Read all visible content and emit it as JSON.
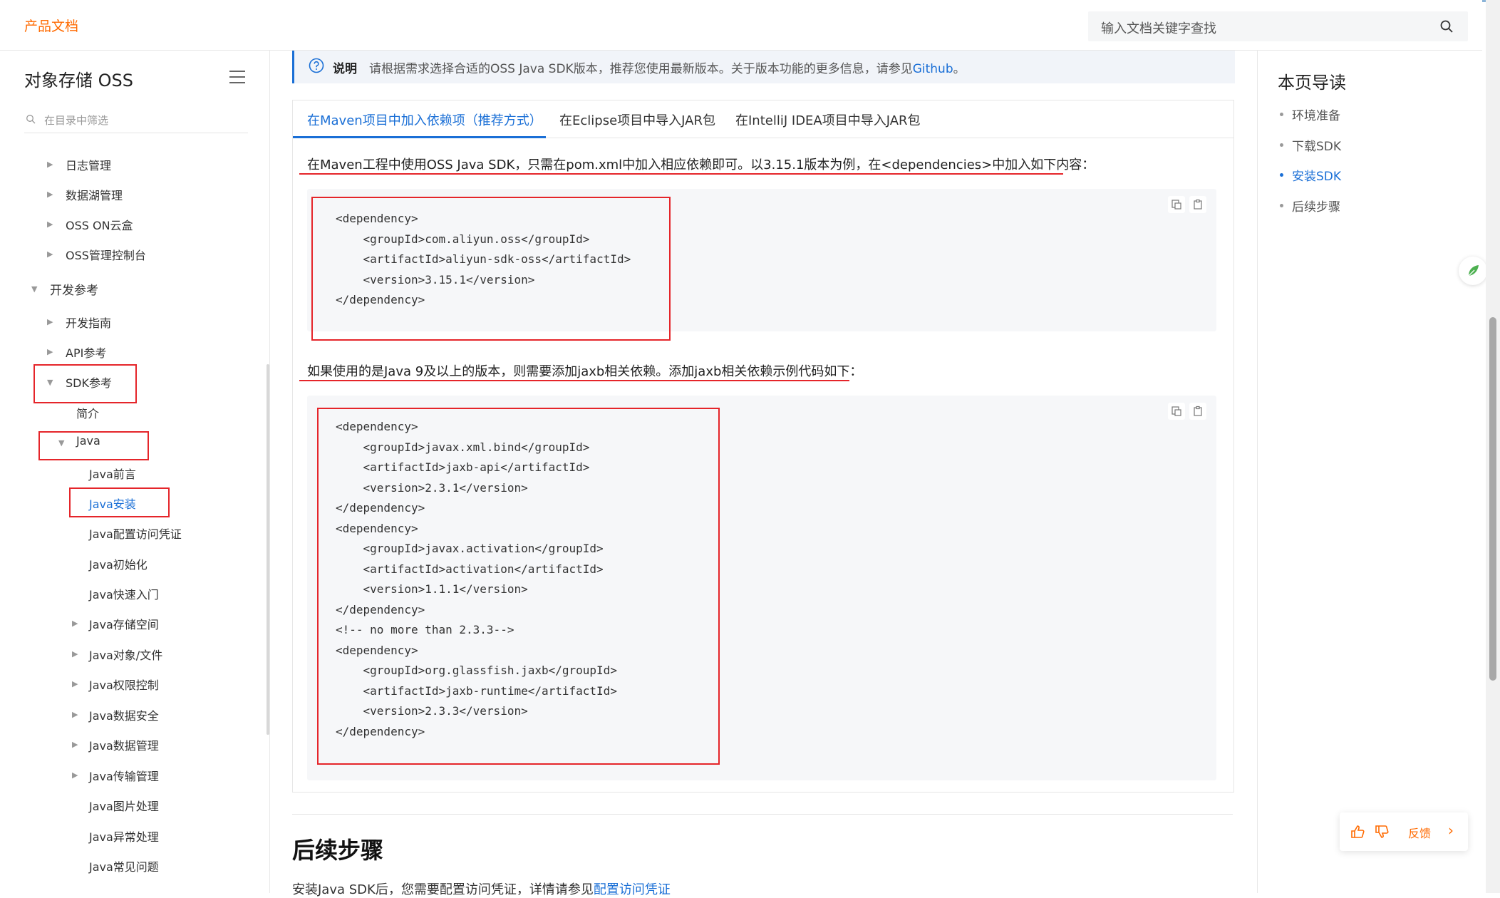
{
  "header": {
    "brand": "产品文档",
    "search_placeholder": "输入文档关键字查找"
  },
  "sidebar": {
    "product_title": "对象存储 OSS",
    "filter_placeholder": "在目录中筛选",
    "items": [
      {
        "label": "日志管理",
        "arrow": "▶"
      },
      {
        "label": "数据湖管理",
        "arrow": "▶"
      },
      {
        "label": "OSS ON云盒",
        "arrow": "▶"
      },
      {
        "label": "OSS管理控制台",
        "arrow": "▶"
      },
      {
        "label": "开发参考",
        "arrow": "▼"
      },
      {
        "label": "开发指南",
        "arrow": "▶"
      },
      {
        "label": "API参考",
        "arrow": "▶"
      },
      {
        "label": "SDK参考",
        "arrow": "▼"
      },
      {
        "label": "简介",
        "arrow": ""
      },
      {
        "label": "Java",
        "arrow": "▼"
      },
      {
        "label": "Java前言",
        "arrow": ""
      },
      {
        "label": "Java安装",
        "arrow": ""
      },
      {
        "label": "Java配置访问凭证",
        "arrow": ""
      },
      {
        "label": "Java初始化",
        "arrow": ""
      },
      {
        "label": "Java快速入门",
        "arrow": ""
      },
      {
        "label": "Java存储空间",
        "arrow": "▶"
      },
      {
        "label": "Java对象/文件",
        "arrow": "▶"
      },
      {
        "label": "Java权限控制",
        "arrow": "▶"
      },
      {
        "label": "Java数据安全",
        "arrow": "▶"
      },
      {
        "label": "Java数据管理",
        "arrow": "▶"
      },
      {
        "label": "Java传输管理",
        "arrow": "▶"
      },
      {
        "label": "Java图片处理",
        "arrow": ""
      },
      {
        "label": "Java异常处理",
        "arrow": ""
      },
      {
        "label": "Java常见问题",
        "arrow": ""
      }
    ]
  },
  "notice": {
    "label": "说明",
    "text": "请根据需求选择合适的OSS Java SDK版本，推荐您使用最新版本。关于版本功能的更多信息，请参见",
    "link": "Github",
    "end": "。"
  },
  "tabs": [
    {
      "label": "在Maven项目中加入依赖项（推荐方式）"
    },
    {
      "label": "在Eclipse项目中导入JAR包"
    },
    {
      "label": "在IntelliJ IDEA项目中导入JAR包"
    }
  ],
  "content": {
    "para1": "在Maven工程中使用OSS Java SDK，只需在pom.xml中加入相应依赖即可。以3.15.1版本为例，在<dependencies>中加入如下内容：",
    "code1": "<dependency>\n    <groupId>com.aliyun.oss</groupId>\n    <artifactId>aliyun-sdk-oss</artifactId>\n    <version>3.15.1</version>\n</dependency>",
    "para2": "如果使用的是Java 9及以上的版本，则需要添加jaxb相关依赖。添加jaxb相关依赖示例代码如下：",
    "code2": "<dependency>\n    <groupId>javax.xml.bind</groupId>\n    <artifactId>jaxb-api</artifactId>\n    <version>2.3.1</version>\n</dependency>\n<dependency>\n    <groupId>javax.activation</groupId>\n    <artifactId>activation</artifactId>\n    <version>1.1.1</version>\n</dependency>\n<!-- no more than 2.3.3-->\n<dependency>\n    <groupId>org.glassfish.jaxb</groupId>\n    <artifactId>jaxb-runtime</artifactId>\n    <version>2.3.3</version>\n</dependency>",
    "section_title": "后续步骤",
    "next_text": "安装Java SDK后，您需要配置访问凭证，详情请参见",
    "next_link": "配置访问凭证"
  },
  "toc": {
    "title": "本页导读",
    "items": [
      {
        "label": "环境准备"
      },
      {
        "label": "下载SDK"
      },
      {
        "label": "安装SDK"
      },
      {
        "label": "后续步骤"
      }
    ]
  },
  "feedback": {
    "label": "反馈",
    "arrow": "›"
  },
  "colors": {
    "brand": "#ff6a00",
    "accent": "#1a6fd6",
    "annotation": "#e5252a"
  }
}
